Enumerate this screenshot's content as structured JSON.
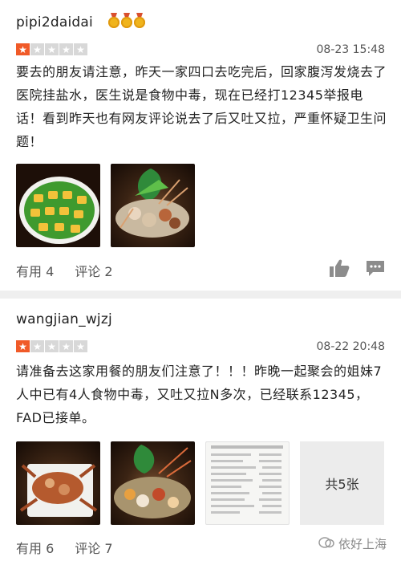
{
  "reviews": [
    {
      "username": "pipi2daidai",
      "medals": 3,
      "rating": 1,
      "date": "08-23 15:48",
      "text": "要去的朋友请注意，昨天一家四口去吃完后，回家腹泻发烧去了医院挂盐水，医生说是食物中毒，现在已经打12345举报电话！看到昨天也有网友评论说去了后又吐又拉，严重怀疑卫生问题！",
      "useful_label": "有用 4",
      "comment_label": "评论 2",
      "photos": [
        "green-dish-photo",
        "seafood-platter-photo"
      ]
    },
    {
      "username": "wangjian_wjzj",
      "rating": 1,
      "date": "08-22 20:48",
      "text": "请准备去这家用餐的朋友们注意了！！！昨晚一起聚会的姐妹7人中已有4人食物中毒，又吐又拉N多次，已经联系12345，FAD已接单。",
      "useful_label": "有用 6",
      "comment_label": "评论 7",
      "photos": [
        "crab-plate-photo",
        "seafood-boat-photo",
        "receipt-photo"
      ],
      "more_photos_label": "共5张"
    }
  ],
  "watermark": "依好上海",
  "colors": {
    "star_on": "#f05a28",
    "star_off": "#d8d8d8",
    "separator": "#efefef"
  },
  "icons": [
    "medal-icon",
    "star-icon",
    "thumbs-up-icon",
    "comment-icon",
    "watermark-logo-icon"
  ]
}
